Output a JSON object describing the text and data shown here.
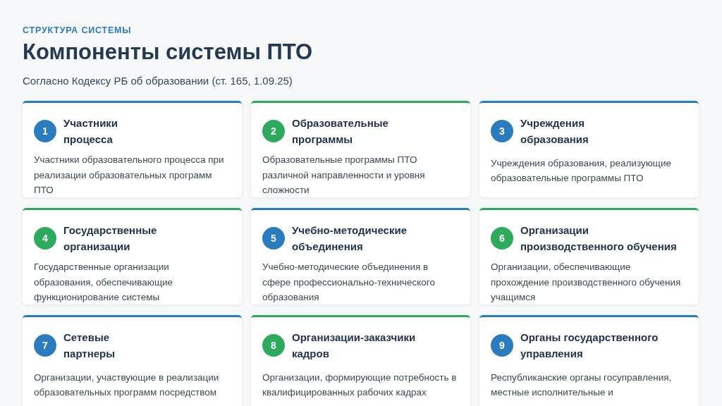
{
  "eyebrow": "СТРУКТУРА СИСТЕМЫ",
  "title": "Компоненты системы ПТО",
  "subtitle": "Согласно Кодексу РБ об образовании (ст. 165, 1.09.25)",
  "cards": [
    {
      "number": "1",
      "color": "#2b7bbf",
      "title": "Участники\nпроцесса",
      "description": "Участники образовательного процесса при реализации образовательных программ ПТО"
    },
    {
      "number": "2",
      "color": "#2eaa5c",
      "title": "Образовательные\nпрограммы",
      "description": "Образовательные программы ПТО различной направленности и уровня сложности"
    },
    {
      "number": "3",
      "color": "#2b7bbf",
      "title": "Учреждения\nобразования",
      "description": "Учреждения образования, реализующие образовательные программы ПТО"
    },
    {
      "number": "4",
      "color": "#2eaa5c",
      "title": "Государственные\nорганизации",
      "description": "Государственные организации образования, обеспечивающие функционирование системы"
    },
    {
      "number": "5",
      "color": "#2b7bbf",
      "title": "Учебно-методические\nобъединения",
      "description": "Учебно-методические объединения в сфере профессионально-технического образования"
    },
    {
      "number": "6",
      "color": "#2eaa5c",
      "title": "Организации\nпроизводственного обучения",
      "description": "Организации, обеспечивающие прохождение производственного обучения учащимся"
    },
    {
      "number": "7",
      "color": "#2b7bbf",
      "title": "Сетевые\nпартнеры",
      "description": "Организации, участвующие в реализации образовательных программ посредством"
    },
    {
      "number": "8",
      "color": "#2eaa5c",
      "title": "Организации-заказчики\nкадров",
      "description": "Организации, формирующие потребность в квалифицированных рабочих кадрах"
    },
    {
      "number": "9",
      "color": "#2b7bbf",
      "title": "Органы государственного\nуправления",
      "description": "Республиканские органы госуправления, местные исполнительные и"
    }
  ]
}
